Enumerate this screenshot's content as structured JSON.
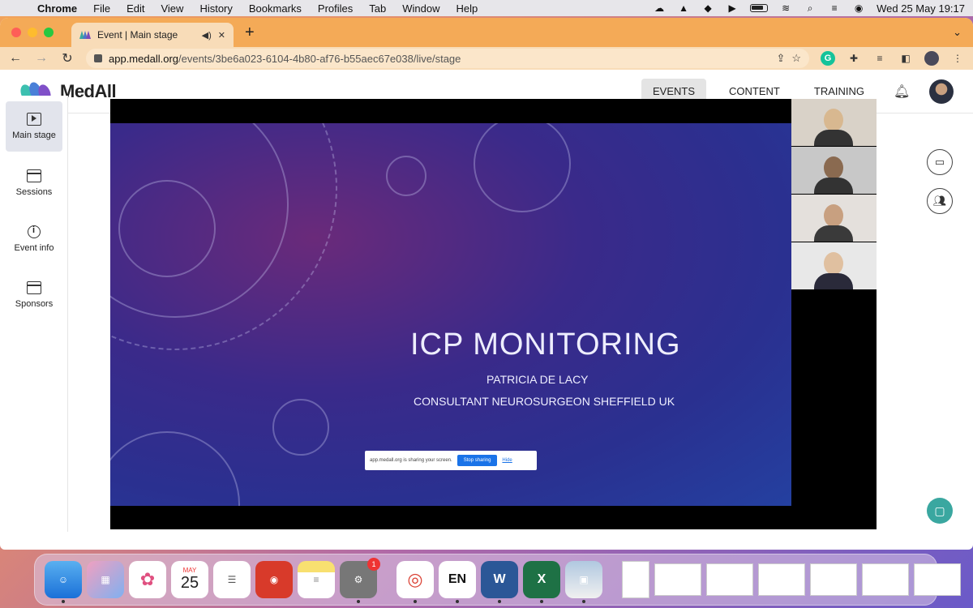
{
  "menubar": {
    "app_name": "Chrome",
    "items": [
      "File",
      "Edit",
      "View",
      "History",
      "Bookmarks",
      "Profiles",
      "Tab",
      "Window",
      "Help"
    ],
    "date_time": "Wed 25 May  19:17"
  },
  "browser": {
    "tab_title": "Event | Main stage",
    "url_domain": "app.medall.org",
    "url_path": "/events/3be6a023-6104-4b80-af76-b55aec67e038/live/stage"
  },
  "app": {
    "logo_text": "MedAll",
    "nav": [
      "EVENTS",
      "CONTENT",
      "TRAINING"
    ],
    "active_nav": "EVENTS"
  },
  "sidebar": {
    "items": [
      {
        "label": "Main stage",
        "icon": "play-screen-icon"
      },
      {
        "label": "Sessions",
        "icon": "calendar-icon"
      },
      {
        "label": "Event info",
        "icon": "info-icon"
      },
      {
        "label": "Sponsors",
        "icon": "calendar-icon"
      }
    ]
  },
  "slide": {
    "title": "ICP MONITORING",
    "presenter": "PATRICIA DE LACY",
    "role": "CONSULTANT NEUROSURGEON SHEFFIELD UK"
  },
  "share_bar": {
    "message": "app.medall.org is sharing your screen.",
    "stop_label": "Stop sharing",
    "hide_label": "Hide"
  },
  "dock": {
    "calendar_month": "MAY",
    "calendar_day": "25",
    "settings_badge": "1",
    "en_label": "EN"
  },
  "colors": {
    "tabbar": "#f4aa57",
    "accent_teal": "#3aa7a0",
    "stop_button": "#1a73e8"
  }
}
